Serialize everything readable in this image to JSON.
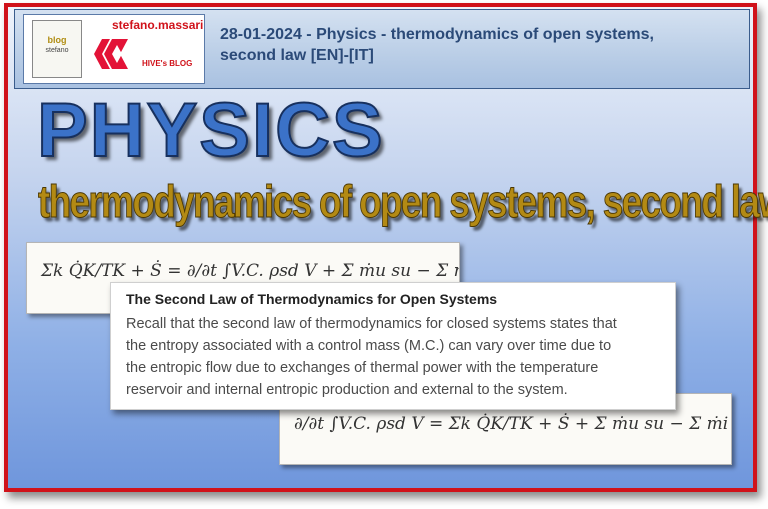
{
  "header": {
    "author": "stefano.massari",
    "blog_label": "HIVE's BLOG",
    "title_line1": "28-01-2024 - Physics - thermodynamics of open systems,",
    "title_line2": "second law [EN]-[IT]",
    "thumb_title": "blog",
    "thumb_sub": "stefano"
  },
  "banner": {
    "subject": "PHYSICS",
    "topic": "thermodynamics of open systems, second law"
  },
  "formulas": {
    "top": "Σk Q̇K/TK + Ṡ = ∂/∂t ∫V.C. ρsd V + Σ ṁu su − Σ ṁi si",
    "bottom": "∂/∂t ∫V.C. ρsd V = Σk Q̇K/TK + Ṡ + Σ ṁu su − Σ ṁi si"
  },
  "excerpt": {
    "title": "The Second Law of Thermodynamics for Open Systems",
    "lines": [
      "Recall that the second law of thermodynamics for closed systems states that",
      "the entropy associated with a control mass (M.C.) can vary over time due to",
      "the entropic flow due to exchanges of thermal power with the temperature",
      "reservoir and internal entropic production and external to the system."
    ]
  },
  "colors": {
    "frame": "#d0121a",
    "subject": "#3b72c8",
    "topic": "#b38a14",
    "header_title": "#2b4a78"
  }
}
